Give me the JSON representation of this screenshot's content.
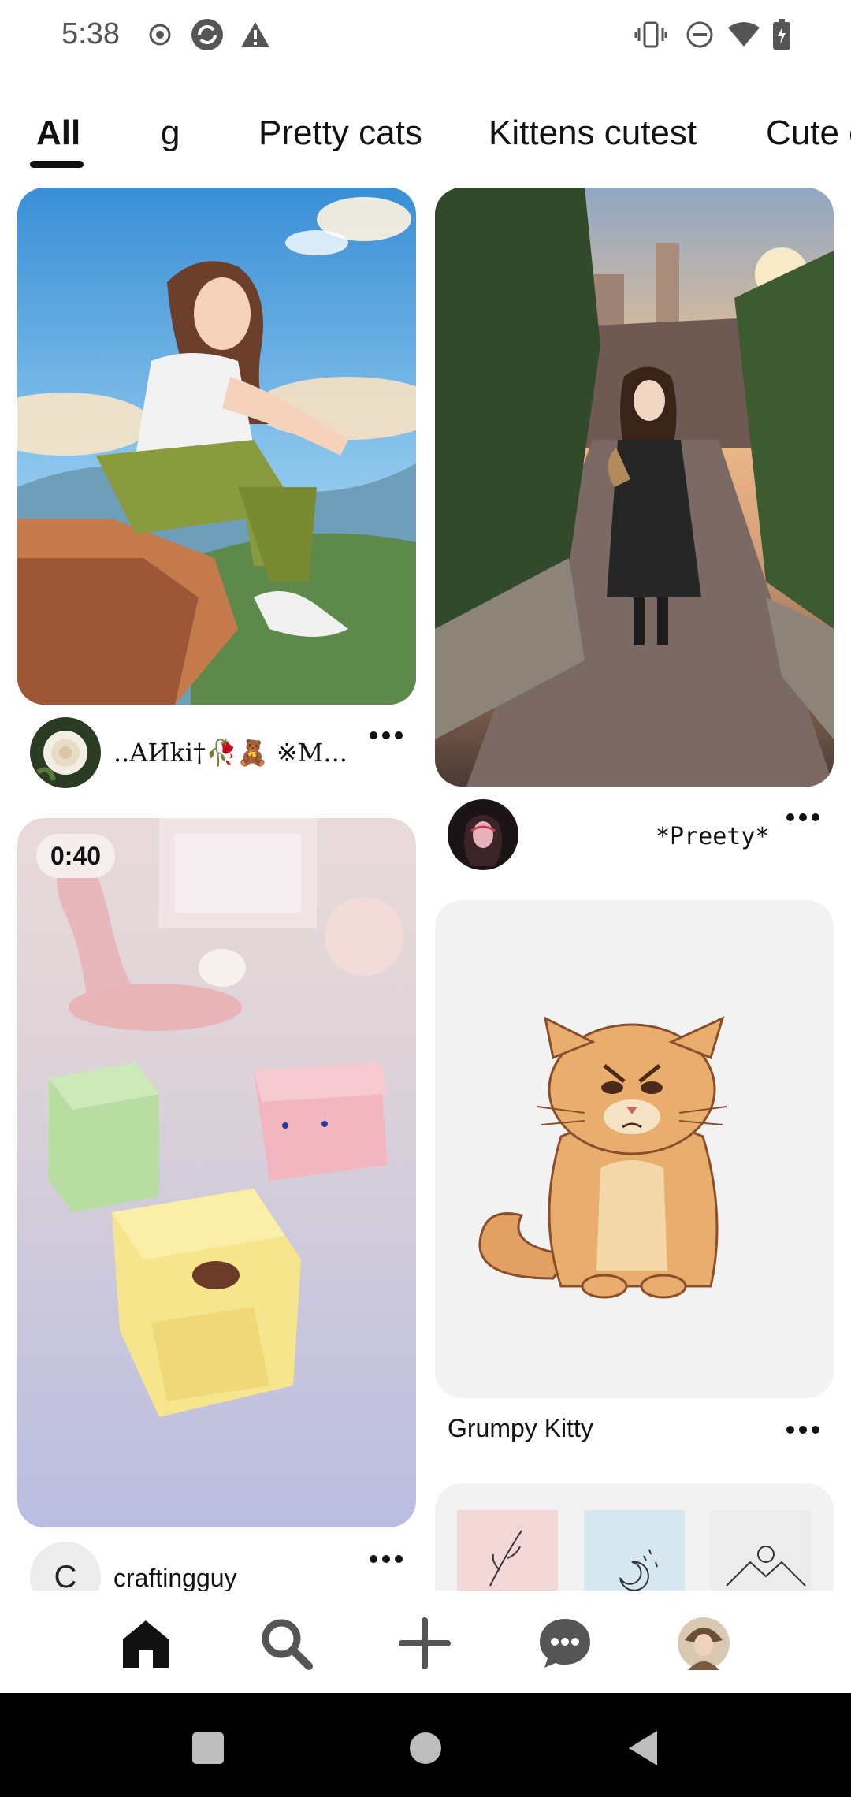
{
  "status_bar": {
    "time": "5:38",
    "left_icons": [
      "record-icon",
      "sync-icon",
      "warning-icon"
    ],
    "right_icons": [
      "vibrate-icon",
      "do-not-disturb-icon",
      "wifi-icon",
      "battery-icon"
    ]
  },
  "tabs": [
    {
      "label": "All",
      "active": true
    },
    {
      "label": "g",
      "active": false
    },
    {
      "label": "Pretty cats",
      "active": false
    },
    {
      "label": "Kittens cutest",
      "active": false
    },
    {
      "label": "Cute c",
      "active": false
    }
  ],
  "pins": [
    {
      "id": "pin1",
      "author": "..AИki†🥀🧸 ※M...",
      "image": "anime-girl-on-rock-illustration"
    },
    {
      "id": "pin2",
      "author": "*Preety*",
      "image": "anime-girl-on-street-at-sunset"
    },
    {
      "id": "pin3",
      "duration": "0:40",
      "author": "craftingguy",
      "avatar_letter": "C",
      "image": "origami-bag-crafts-video"
    },
    {
      "id": "pin4",
      "title": "Grumpy Kitty",
      "image": "grumpy-cat-illustration"
    },
    {
      "id": "pin5",
      "image": "minimal-art-prints-collage"
    }
  ],
  "bottom_nav": [
    "home-icon",
    "search-icon",
    "create-icon",
    "messages-icon",
    "profile-avatar"
  ],
  "system_nav": [
    "recents-icon",
    "home-circle-icon",
    "back-icon"
  ],
  "colors": {
    "accent": "#111111",
    "background": "#ffffff",
    "card_bg": "#f2f2f2"
  }
}
